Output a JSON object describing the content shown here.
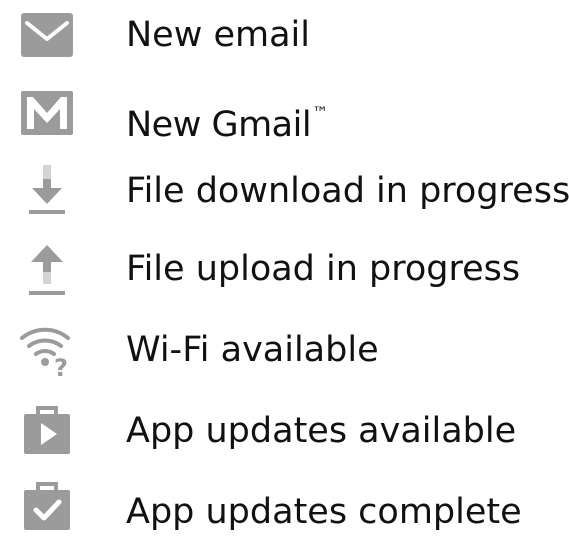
{
  "items": [
    {
      "icon": "email-icon",
      "label": "New email"
    },
    {
      "icon": "gmail-icon",
      "label": "New Gmail",
      "mark": "™"
    },
    {
      "icon": "download-icon",
      "label": "File download in progress"
    },
    {
      "icon": "upload-icon",
      "label": "File upload in progress"
    },
    {
      "icon": "wifi-question-icon",
      "label": "Wi-Fi available"
    },
    {
      "icon": "app-play-icon",
      "label": "App updates available"
    },
    {
      "icon": "app-check-icon",
      "label": "App updates complete"
    }
  ],
  "colors": {
    "icon": "#9b9b9b",
    "icon_light": "#d3d3d3",
    "text": "#111111",
    "background": "#ffffff"
  }
}
